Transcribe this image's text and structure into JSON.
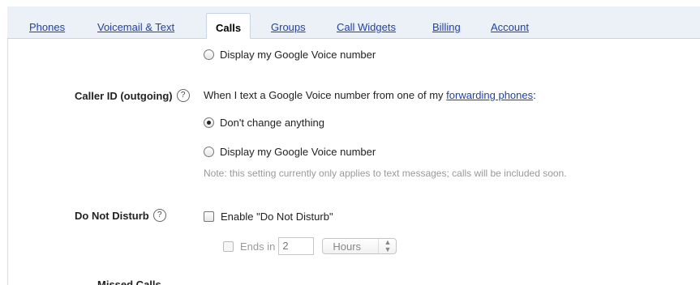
{
  "tabs": [
    {
      "label": "Phones",
      "active": false
    },
    {
      "label": "Voicemail & Text",
      "active": false
    },
    {
      "label": "Calls",
      "active": true
    },
    {
      "label": "Groups",
      "active": false
    },
    {
      "label": "Call Widgets",
      "active": false
    },
    {
      "label": "Billing",
      "active": false
    },
    {
      "label": "Account",
      "active": false
    }
  ],
  "top_option": {
    "label": "Display my Google Voice number",
    "checked": false
  },
  "caller_id": {
    "label": "Caller ID (outgoing)",
    "help": "?",
    "description_prefix": "When I text a Google Voice number from one of my ",
    "description_link": "forwarding phones",
    "description_suffix": ":",
    "options": [
      {
        "label": "Don't change anything",
        "checked": true
      },
      {
        "label": "Display my Google Voice number",
        "checked": false
      }
    ],
    "note": "Note: this setting currently only applies to text messages; calls will be included soon."
  },
  "do_not_disturb": {
    "label": "Do Not Disturb",
    "help": "?",
    "enable_label": "Enable \"Do Not Disturb\"",
    "enabled": false,
    "ends_in_label": "Ends in",
    "ends_in_value": "2",
    "unit_selected": "Hours"
  },
  "next_section_partial": "Missed Calls"
}
